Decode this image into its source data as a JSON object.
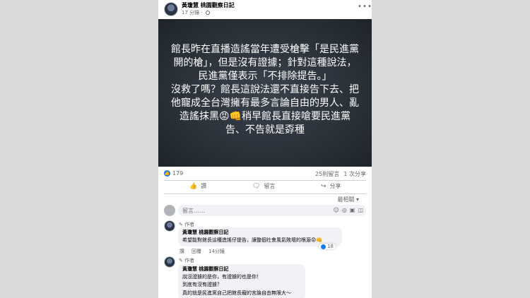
{
  "post": {
    "author": "黃瓊慧 桃園觀察日記",
    "time": "17 分鐘",
    "image_text": "館長昨在直播造謠當年遭受槍擊「是民進黨開的槍」，但是沒有證據；針對這種說法，民進黨僅表示「不排除提告。」\n沒救了嗎？館長這說法還不直接告下去、把他寵成全台灣擁有最多言論自由的男人、亂造謠抹黑😡👊稍早館長直接嗆要民進黨告、不告就是孬種",
    "like_count": "179",
    "comment_count": "25則留言",
    "share_count": "1 次分享"
  },
  "actions": {
    "like": "讚",
    "comment": "留言",
    "share": "分享"
  },
  "sort": "最相關",
  "comment_box": {
    "placeholder": "留言……"
  },
  "comments": [
    {
      "author_tag": "作者",
      "author": "黃瓊慧 桃園觀察日記",
      "lines": [
        "希望能對館長這種造謠仔提告，讓整個社會風氣敗壞的根源😡👊"
      ],
      "reaction_count": "18",
      "like": "讚",
      "reply": "回覆",
      "time": "14分鐘"
    },
    {
      "author_tag": "作者",
      "author": "黃瓊慧 桃園觀察日記",
      "lines": [
        "說沒證據的是你，有證據的也是你！",
        "到底有沒有證據？",
        "真的就是民進黨自己把館長寵的言論自由無限大～"
      ]
    }
  ],
  "colors": {
    "accent": "#1877f2",
    "image_bg": "#2b3139"
  }
}
